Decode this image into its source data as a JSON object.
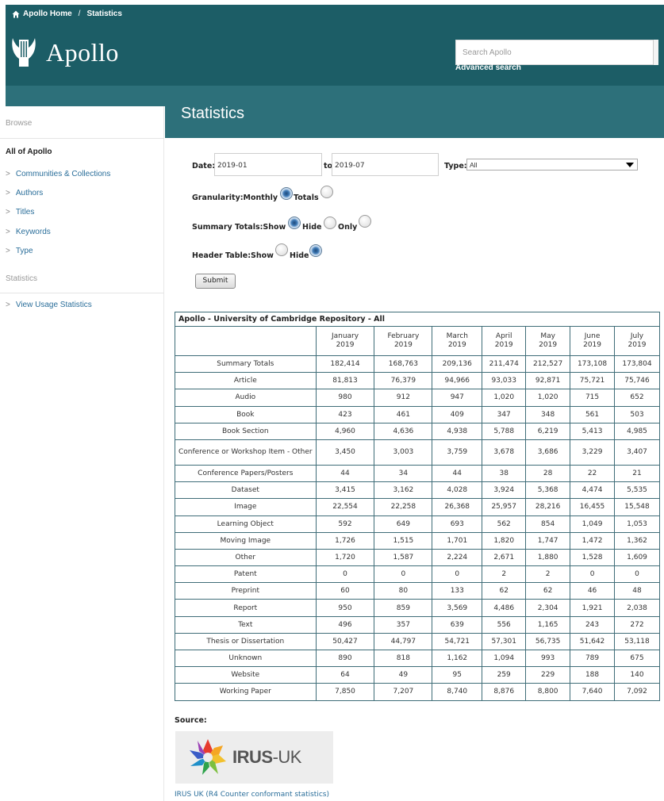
{
  "header": {
    "breadcrumb_home": "Apollo Home",
    "breadcrumb_sep": "/",
    "breadcrumb_current": "Statistics",
    "logo_text": "Apollo",
    "search_placeholder": "Search Apollo",
    "advanced_search": "Advanced search"
  },
  "sidebar": {
    "browse_heading": "Browse",
    "all_of_apollo": "All of Apollo",
    "items": [
      {
        "label": "Communities & Collections"
      },
      {
        "label": "Authors"
      },
      {
        "label": "Titles"
      },
      {
        "label": "Keywords"
      },
      {
        "label": "Type"
      }
    ],
    "statistics_heading": "Statistics",
    "statistics_items": [
      {
        "label": "View Usage Statistics"
      }
    ],
    "chevron": ">"
  },
  "page": {
    "title": "Statistics"
  },
  "form": {
    "date_label": "Date:",
    "date_from": "2019-01",
    "to_label": "to",
    "date_to": "2019-07",
    "type_label": "Type:",
    "type_value": "All",
    "granularity_label": "Granularity:Monthly",
    "granularity_totals": "Totals",
    "granularity_selected": "Monthly",
    "summary_label": "Summary Totals:Show",
    "summary_hide": "Hide",
    "summary_only": "Only",
    "summary_selected": "Show",
    "header_table_label": "Header Table:Show",
    "header_table_hide": "Hide",
    "header_table_selected": "Hide",
    "submit_label": "Submit"
  },
  "table": {
    "caption": "Apollo - University of Cambridge Repository - All",
    "columns": [
      {
        "month": "January",
        "year": "2019"
      },
      {
        "month": "February",
        "year": "2019"
      },
      {
        "month": "March",
        "year": "2019"
      },
      {
        "month": "April",
        "year": "2019"
      },
      {
        "month": "May",
        "year": "2019"
      },
      {
        "month": "June",
        "year": "2019"
      },
      {
        "month": "July",
        "year": "2019"
      }
    ],
    "rows": [
      {
        "label": "Summary Totals",
        "values": [
          "182,414",
          "168,763",
          "209,136",
          "211,474",
          "212,527",
          "173,108",
          "173,804"
        ]
      },
      {
        "label": "Article",
        "values": [
          "81,813",
          "76,379",
          "94,966",
          "93,033",
          "92,871",
          "75,721",
          "75,746"
        ]
      },
      {
        "label": "Audio",
        "values": [
          "980",
          "912",
          "947",
          "1,020",
          "1,020",
          "715",
          "652"
        ]
      },
      {
        "label": "Book",
        "values": [
          "423",
          "461",
          "409",
          "347",
          "348",
          "561",
          "503"
        ]
      },
      {
        "label": "Book Section",
        "values": [
          "4,960",
          "4,636",
          "4,938",
          "5,788",
          "6,219",
          "5,413",
          "4,985"
        ]
      },
      {
        "label": "Conference or Workshop Item - Other",
        "values": [
          "3,450",
          "3,003",
          "3,759",
          "3,678",
          "3,686",
          "3,229",
          "3,407"
        ]
      },
      {
        "label": "Conference Papers/Posters",
        "values": [
          "44",
          "34",
          "44",
          "38",
          "28",
          "22",
          "21"
        ]
      },
      {
        "label": "Dataset",
        "values": [
          "3,415",
          "3,162",
          "4,028",
          "3,924",
          "5,368",
          "4,474",
          "5,535"
        ]
      },
      {
        "label": "Image",
        "values": [
          "22,554",
          "22,258",
          "26,368",
          "25,957",
          "28,216",
          "16,455",
          "15,548"
        ]
      },
      {
        "label": "Learning Object",
        "values": [
          "592",
          "649",
          "693",
          "562",
          "854",
          "1,049",
          "1,053"
        ]
      },
      {
        "label": "Moving Image",
        "values": [
          "1,726",
          "1,515",
          "1,701",
          "1,820",
          "1,747",
          "1,472",
          "1,362"
        ]
      },
      {
        "label": "Other",
        "values": [
          "1,720",
          "1,587",
          "2,224",
          "2,671",
          "1,880",
          "1,528",
          "1,609"
        ]
      },
      {
        "label": "Patent",
        "values": [
          "0",
          "0",
          "0",
          "2",
          "2",
          "0",
          "0"
        ]
      },
      {
        "label": "Preprint",
        "values": [
          "60",
          "80",
          "133",
          "62",
          "62",
          "46",
          "48"
        ]
      },
      {
        "label": "Report",
        "values": [
          "950",
          "859",
          "3,569",
          "4,486",
          "2,304",
          "1,921",
          "2,038"
        ]
      },
      {
        "label": "Text",
        "values": [
          "496",
          "357",
          "639",
          "556",
          "1,165",
          "243",
          "272"
        ]
      },
      {
        "label": "Thesis or Dissertation",
        "values": [
          "50,427",
          "44,797",
          "54,721",
          "57,301",
          "56,735",
          "51,642",
          "53,118"
        ]
      },
      {
        "label": "Unknown",
        "values": [
          "890",
          "818",
          "1,162",
          "1,094",
          "993",
          "789",
          "675"
        ]
      },
      {
        "label": "Website",
        "values": [
          "64",
          "49",
          "95",
          "259",
          "229",
          "188",
          "140"
        ]
      },
      {
        "label": "Working Paper",
        "values": [
          "7,850",
          "7,207",
          "8,740",
          "8,876",
          "8,800",
          "7,640",
          "7,092"
        ]
      }
    ]
  },
  "source": {
    "label": "Source:",
    "logo_text_main": "IRUS",
    "logo_text_suffix": "-UK",
    "link_text": "IRUS UK (R4 Counter conformant statistics)"
  },
  "colors": {
    "header_teal": "#1c5d66",
    "band_teal": "#2d707a",
    "link_blue": "#2a6e9a",
    "table_border": "#3f6d78"
  },
  "icons": {
    "home": "home-icon",
    "logo": "lyre-icon",
    "select": "dropdown-arrow-icon",
    "irus": "irus-star-icon"
  }
}
